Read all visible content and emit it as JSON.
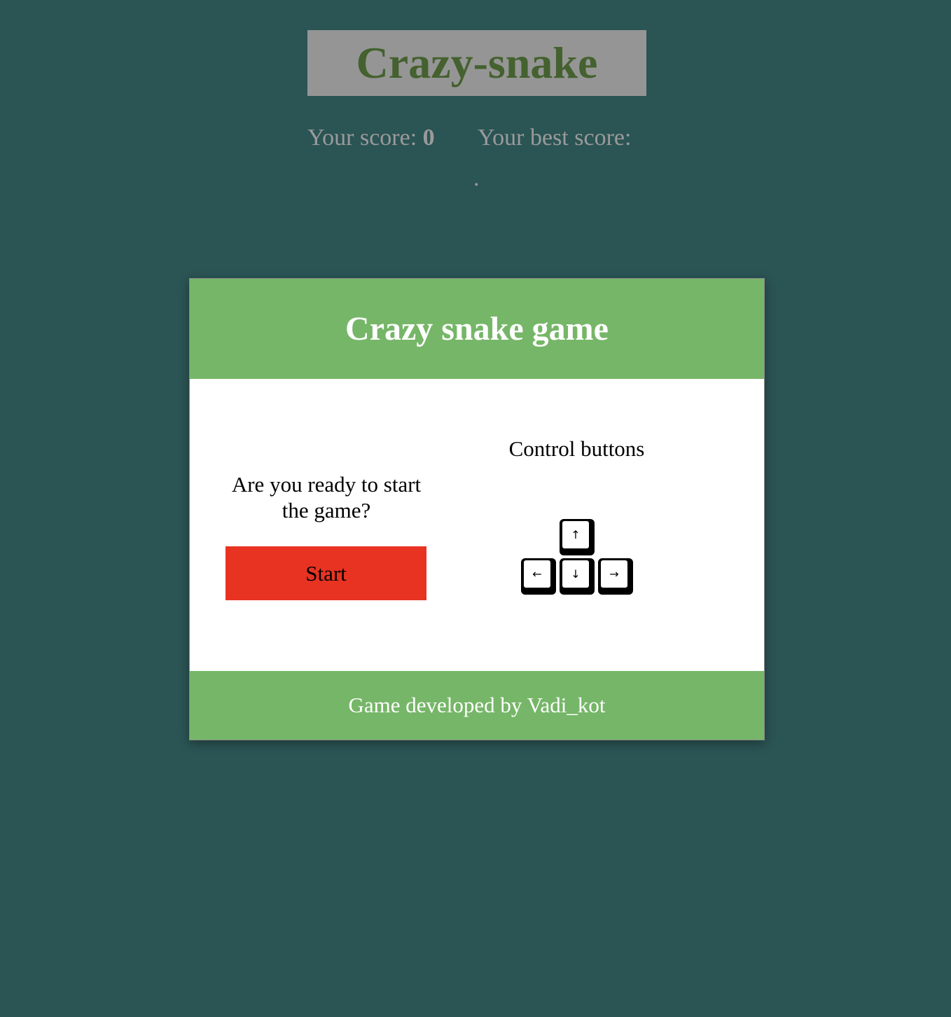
{
  "header": {
    "title": "Crazy-snake"
  },
  "scores": {
    "current_label": "Your score:",
    "current_value": "0",
    "best_label": "Your best score:",
    "best_value": "."
  },
  "card": {
    "title": "Crazy snake game",
    "ready_text": "Are you ready to start the game?",
    "start_label": "Start",
    "controls_title": "Control buttons",
    "keys": {
      "up": "↑",
      "left": "←",
      "down": "↓",
      "right": "→"
    },
    "footer": "Game developed by Vadi_kot"
  },
  "colors": {
    "background": "#2b5454",
    "title_box": "#959595",
    "title_text": "#44612f",
    "card_header": "#76b668",
    "start_button": "#e83323",
    "score_text": "#9a9a9a"
  }
}
